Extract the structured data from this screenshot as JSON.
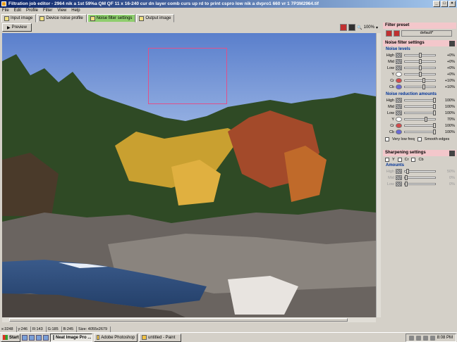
{
  "window": {
    "title": "Filtration job editor - 2964 nik a 1st 59%a QM QF 11 x 16-240 cur dn layer comb curs up rd to print cspro low nik a dvpro1 660 vr 1 7P3M2964.tif"
  },
  "menu": [
    "File",
    "Edit",
    "Profile",
    "Filter",
    "View",
    "Help"
  ],
  "tabs": [
    "Input image",
    "Device noise profile",
    "Noise filter settings",
    "Output image"
  ],
  "toolbar": {
    "preview_label": "Preview",
    "zoom": "100%"
  },
  "status": [
    "x:3248",
    "y:246",
    "R:143",
    "G:185",
    "B:245",
    "Size: 4055x2679"
  ],
  "panel": {
    "filter_preset": {
      "title": "Filter preset",
      "preset_value": "default*"
    },
    "noise_filter": {
      "title": "Noise filter settings",
      "levels_title": "Noise levels",
      "levels": [
        {
          "label": "High",
          "value": "+0%"
        },
        {
          "label": "Mid",
          "value": "+0%"
        },
        {
          "label": "Low",
          "value": "+0%"
        },
        {
          "label": "Y",
          "value": "+0%"
        },
        {
          "label": "Cr",
          "value": "+10%"
        },
        {
          "label": "Cb",
          "value": "+10%"
        }
      ],
      "reduction_title": "Noise reduction amounts",
      "reduction": [
        {
          "label": "High",
          "value": "100%"
        },
        {
          "label": "Mid",
          "value": "100%"
        },
        {
          "label": "Low",
          "value": "100%"
        },
        {
          "label": "Y",
          "value": "70%"
        },
        {
          "label": "Cr",
          "value": "100%"
        },
        {
          "label": "Cb",
          "value": "100%"
        }
      ],
      "very_low_freq": "Very low freq",
      "smooth_edges": "Smooth edges"
    },
    "sharpening": {
      "title": "Sharpening settings",
      "channels": [
        "Y",
        "Cr",
        "Cb"
      ],
      "amounts_title": "Amounts",
      "amounts": [
        {
          "label": "High",
          "value": "50%"
        },
        {
          "label": "Mid",
          "value": "0%"
        },
        {
          "label": "Low",
          "value": "0%"
        }
      ]
    }
  },
  "taskbar": {
    "start": "Start",
    "tasks": [
      "Neat Image Pro ...",
      "Adobe Photoshop",
      "untitled - Paint"
    ],
    "clock": "8:08 PM"
  }
}
